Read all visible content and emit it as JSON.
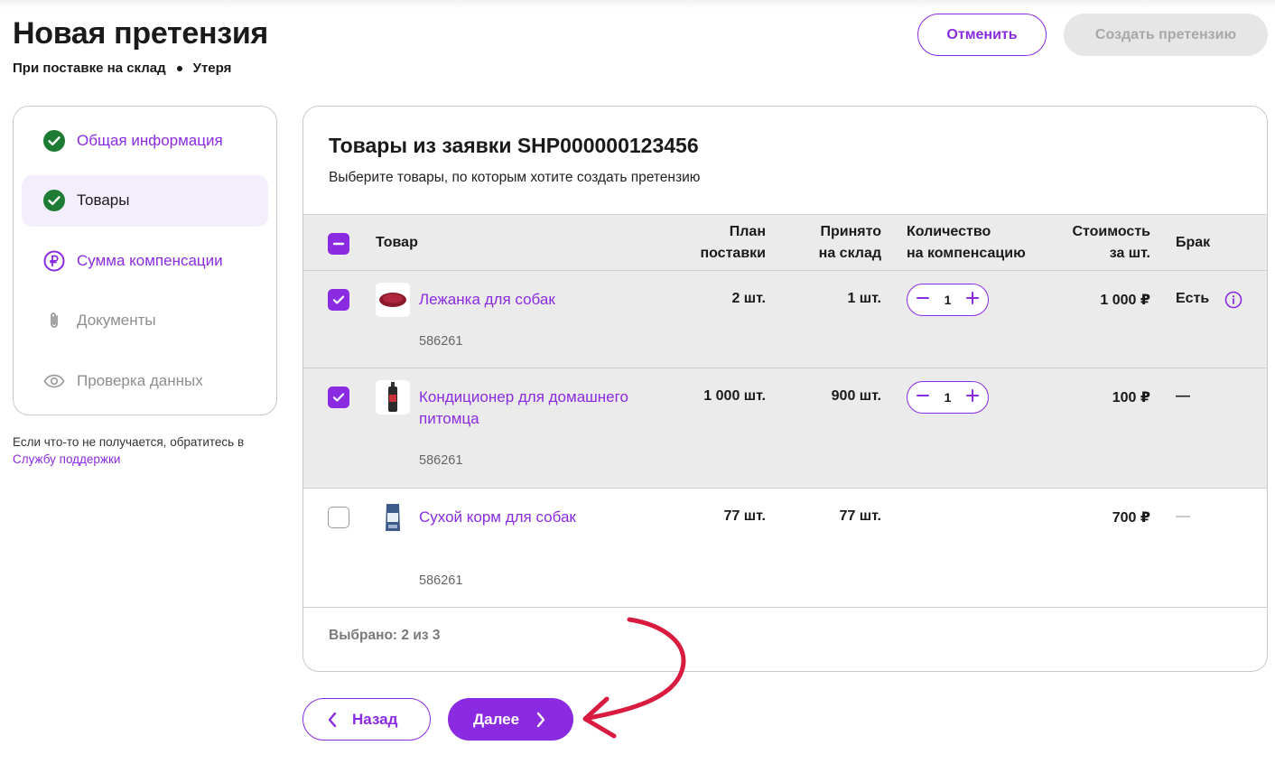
{
  "header": {
    "title": "Новая претензия",
    "subtitle_part1": "При поставке на склад",
    "subtitle_part2": "Утеря",
    "cancel_label": "Отменить",
    "create_label": "Создать претензию"
  },
  "stepper": {
    "items": [
      {
        "label": "Общая информация",
        "state": "done",
        "icon": "check-circle-icon"
      },
      {
        "label": "Товары",
        "state": "active",
        "icon": "check-circle-icon"
      },
      {
        "label": "Сумма компенсации",
        "state": "current",
        "icon": "ruble-circle-icon"
      },
      {
        "label": "Документы",
        "state": "todo",
        "icon": "paperclip-icon"
      },
      {
        "label": "Проверка данных",
        "state": "todo",
        "icon": "eye-icon"
      }
    ]
  },
  "help": {
    "text": "Если что-то не получается, обратитесь в ",
    "link": "Службу поддержки"
  },
  "card": {
    "title": "Товары из заявки SHP000000123456",
    "subtitle": "Выберите товары, по которым хотите создать претензию",
    "columns": {
      "product": "Товар",
      "plan_1": "План",
      "plan_2": "поставки",
      "accepted_1": "Принято",
      "accepted_2": "на склад",
      "qty_1": "Количество",
      "qty_2": "на компенсацию",
      "price_1": "Стоимость",
      "price_2": "за шт.",
      "defect": "Брак"
    },
    "rows": [
      {
        "name": "Лежанка для собак",
        "sku": "586261",
        "plan": "2 шт.",
        "accepted": "1 шт.",
        "qty": "1",
        "price": "1 000 ₽",
        "defect": "Есть",
        "checked": true
      },
      {
        "name_1": "Кондиционер для домашнего",
        "name_2": "питомца",
        "sku": "586261",
        "plan": "1 000 шт.",
        "accepted": "900 шт.",
        "qty": "1",
        "price": "100 ₽",
        "defect": "—",
        "checked": true
      },
      {
        "name": "Сухой корм для собак",
        "sku": "586261",
        "plan": "77 шт.",
        "accepted": "77 шт.",
        "price": "700 ₽",
        "defect": "—",
        "checked": false
      }
    ],
    "selected_count": "Выбрано: 2 из 3"
  },
  "footer": {
    "back_label": "Назад",
    "next_label": "Далее"
  },
  "colors": {
    "accent": "#8a2be2",
    "success": "#1e7b34",
    "arrow": "#d81b3f"
  }
}
